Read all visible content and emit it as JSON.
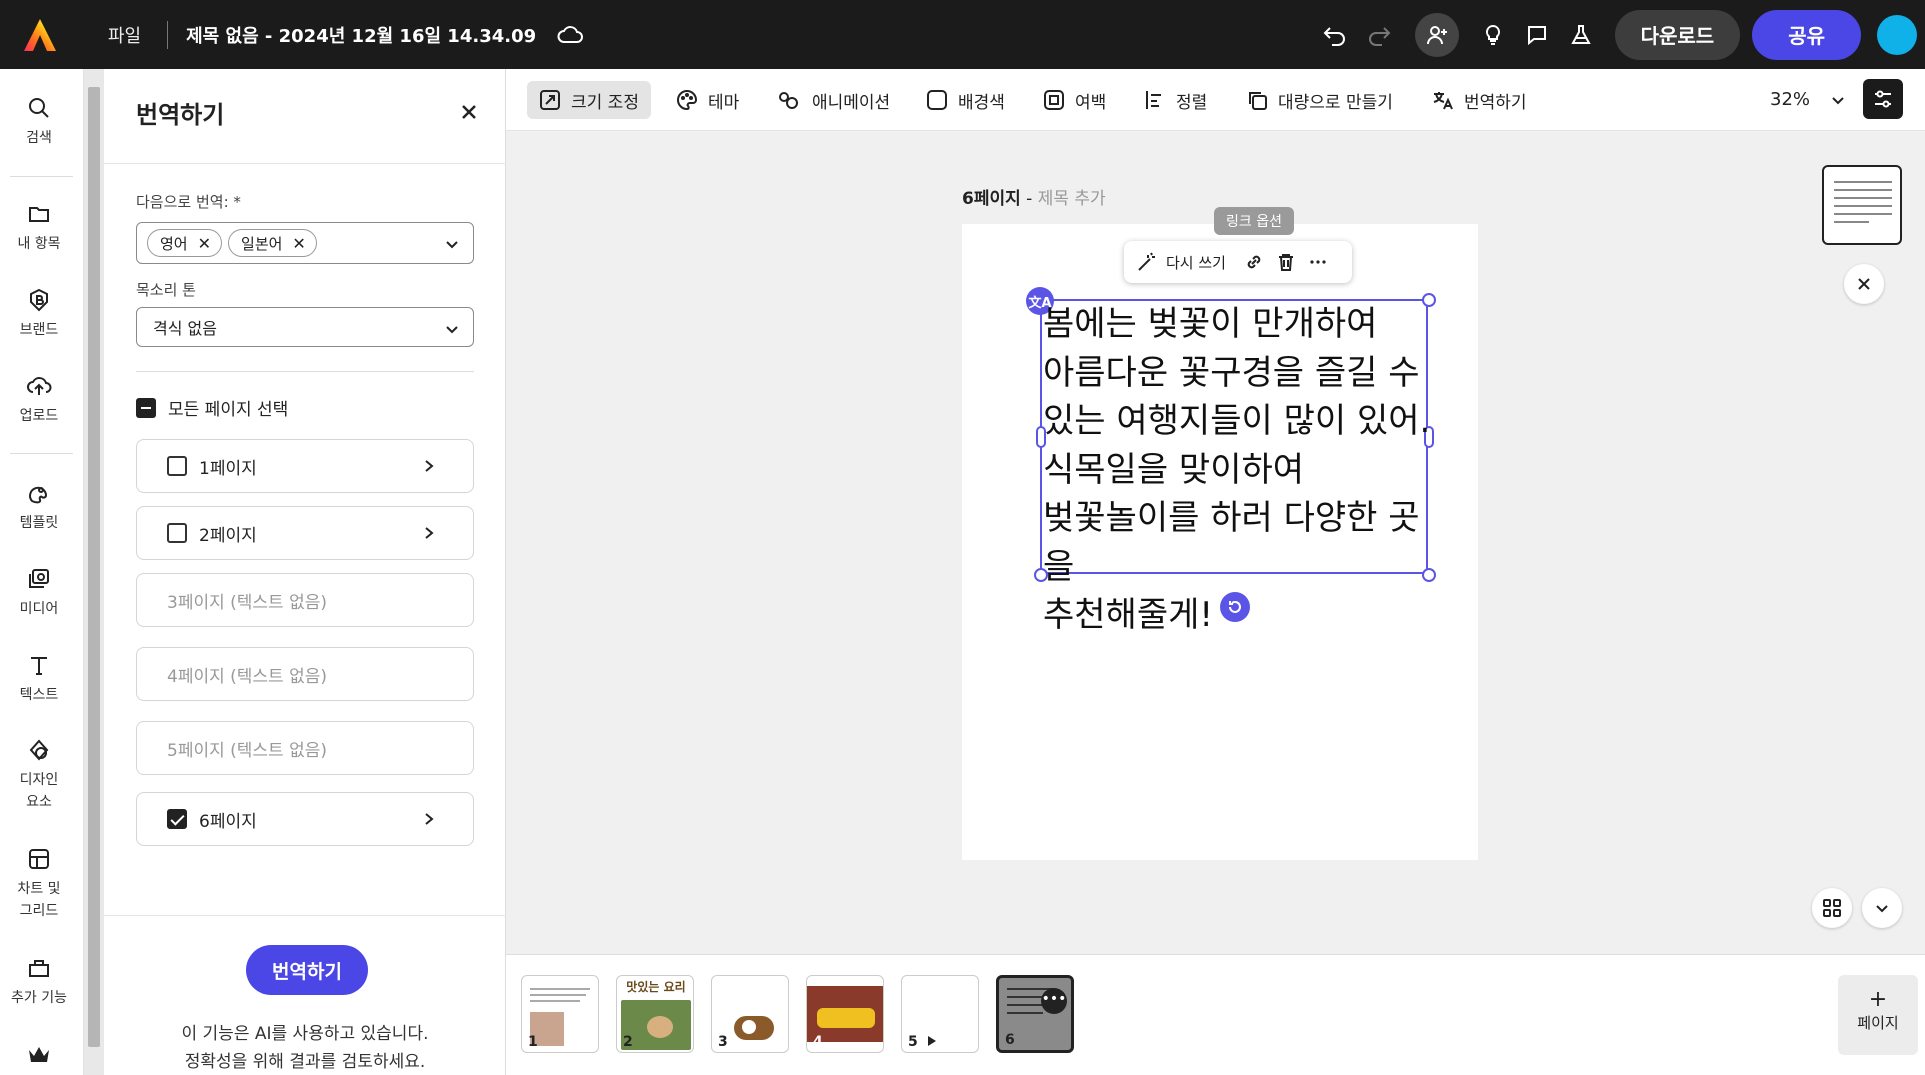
{
  "topbar": {
    "file_menu": "파일",
    "document_title": "제목 없음 - 2024년 12월 16일 14.34.09",
    "download_label": "다운로드",
    "share_label": "공유",
    "colors": {
      "background": "#1b1b1b",
      "share": "#4b47e6"
    }
  },
  "rail": {
    "items": [
      {
        "label": "검색",
        "icon": "search-icon"
      },
      {
        "label": "내 항목",
        "icon": "folder-icon"
      },
      {
        "label": "브랜드",
        "icon": "brand-icon"
      },
      {
        "label": "업로드",
        "icon": "upload-cloud-icon"
      },
      {
        "label": "템플릿",
        "icon": "template-icon"
      },
      {
        "label": "미디어",
        "icon": "media-icon"
      },
      {
        "label": "텍스트",
        "icon": "text-icon"
      },
      {
        "label": "디자인\n요소",
        "label_lines": [
          "디자인",
          "요소"
        ],
        "icon": "shapes-icon"
      },
      {
        "label": "차트 및\n그리드",
        "label_lines": [
          "차트 및",
          "그리드"
        ],
        "icon": "chart-grid-icon"
      },
      {
        "label": "추가 기능",
        "icon": "addons-icon"
      }
    ]
  },
  "panel": {
    "title": "번역하기",
    "translate_to_label": "다음으로 번역: *",
    "languages": [
      "영어",
      "일본어"
    ],
    "tone_label": "목소리 톤",
    "tone_value": "격식 없음",
    "select_all_label": "모든 페이지 선택",
    "pages": [
      {
        "label": "1페이지",
        "checked": false,
        "enabled": true
      },
      {
        "label": "2페이지",
        "checked": false,
        "enabled": true
      },
      {
        "label": "3페이지 (텍스트 없음)",
        "checked": false,
        "enabled": false
      },
      {
        "label": "4페이지 (텍스트 없음)",
        "checked": false,
        "enabled": false
      },
      {
        "label": "5페이지 (텍스트 없음)",
        "checked": false,
        "enabled": false
      },
      {
        "label": "6페이지",
        "checked": true,
        "enabled": true
      }
    ],
    "translate_button": "번역하기",
    "note_line1": "이 기능은 AI를 사용하고 있습니다.",
    "note_line2": "정확성을 위해 결과를 검토하세요."
  },
  "toolbar": {
    "items": [
      {
        "label": "크기 조정",
        "icon": "resize-icon",
        "active": true
      },
      {
        "label": "테마",
        "icon": "palette-icon"
      },
      {
        "label": "애니메이션",
        "icon": "animation-icon"
      },
      {
        "label": "배경색",
        "icon": "background-color-icon"
      },
      {
        "label": "여백",
        "icon": "padding-icon"
      },
      {
        "label": "정렬",
        "icon": "align-icon"
      },
      {
        "label": "대량으로 만들기",
        "icon": "bulk-create-icon"
      },
      {
        "label": "번역하기",
        "icon": "translate-icon"
      }
    ],
    "zoom": "32%"
  },
  "canvas": {
    "page_title": "6페이지",
    "page_subtitle": "제목 추가",
    "link_tooltip": "링크 옵션",
    "rewrite_label": "다시 쓰기",
    "text_lines": [
      "봄에는 벚꽃이 만개하여",
      "아름다운 꽃구경을 즐길 수",
      "있는 여행지들이 많이 있어.",
      "식목일을 맞이하여",
      "벚꽃놀이를 하러 다양한 곳을",
      "추천해줄게!"
    ],
    "selection_color": "#5a55e6"
  },
  "strip": {
    "pages": [
      {
        "number": "1"
      },
      {
        "number": "2",
        "caption": "맛있는 요리"
      },
      {
        "number": "3"
      },
      {
        "number": "4"
      },
      {
        "number": "5"
      },
      {
        "number": "6",
        "selected": true
      }
    ],
    "add_page_label": "페이지",
    "add_page_plus": "+"
  }
}
